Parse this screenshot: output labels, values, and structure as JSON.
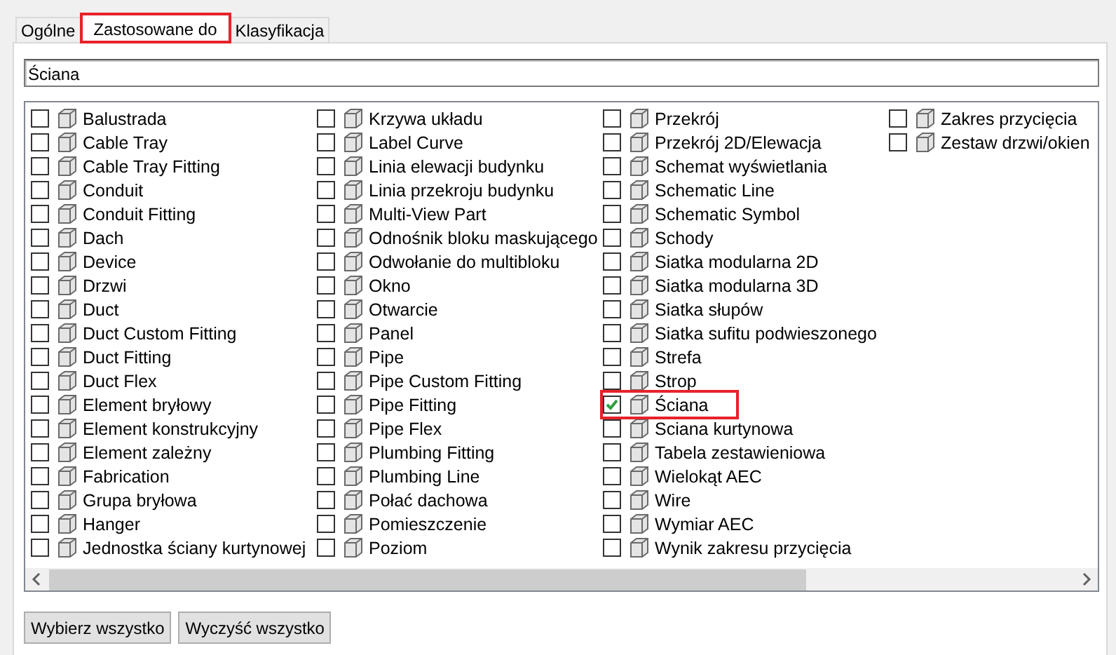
{
  "tabs": [
    {
      "label": "Ogólne",
      "selected": false,
      "highlighted": false
    },
    {
      "label": "Zastosowane do",
      "selected": true,
      "highlighted": true
    },
    {
      "label": "Klasyfikacja",
      "selected": false,
      "highlighted": false
    }
  ],
  "filter": {
    "value": "Ściana"
  },
  "columns": [
    {
      "items": [
        {
          "label": "Balustrada",
          "checked": false
        },
        {
          "label": "Cable Tray",
          "checked": false
        },
        {
          "label": "Cable Tray Fitting",
          "checked": false
        },
        {
          "label": "Conduit",
          "checked": false
        },
        {
          "label": "Conduit Fitting",
          "checked": false
        },
        {
          "label": "Dach",
          "checked": false
        },
        {
          "label": "Device",
          "checked": false
        },
        {
          "label": "Drzwi",
          "checked": false
        },
        {
          "label": "Duct",
          "checked": false
        },
        {
          "label": "Duct Custom Fitting",
          "checked": false
        },
        {
          "label": "Duct Fitting",
          "checked": false
        },
        {
          "label": "Duct Flex",
          "checked": false
        },
        {
          "label": "Element bryłowy",
          "checked": false
        },
        {
          "label": "Element konstrukcyjny",
          "checked": false
        },
        {
          "label": "Element zależny",
          "checked": false
        },
        {
          "label": "Fabrication",
          "checked": false
        },
        {
          "label": "Grupa bryłowa",
          "checked": false
        },
        {
          "label": "Hanger",
          "checked": false
        },
        {
          "label": "Jednostka ściany kurtynowej",
          "checked": false
        }
      ]
    },
    {
      "items": [
        {
          "label": "Krzywa układu",
          "checked": false
        },
        {
          "label": "Label Curve",
          "checked": false
        },
        {
          "label": "Linia elewacji budynku",
          "checked": false
        },
        {
          "label": "Linia przekroju budynku",
          "checked": false
        },
        {
          "label": "Multi-View Part",
          "checked": false
        },
        {
          "label": "Odnośnik bloku maskującego",
          "checked": false
        },
        {
          "label": "Odwołanie do multibloku",
          "checked": false
        },
        {
          "label": "Okno",
          "checked": false
        },
        {
          "label": "Otwarcie",
          "checked": false
        },
        {
          "label": "Panel",
          "checked": false
        },
        {
          "label": "Pipe",
          "checked": false
        },
        {
          "label": "Pipe Custom Fitting",
          "checked": false
        },
        {
          "label": "Pipe Fitting",
          "checked": false
        },
        {
          "label": "Pipe Flex",
          "checked": false
        },
        {
          "label": "Plumbing Fitting",
          "checked": false
        },
        {
          "label": "Plumbing Line",
          "checked": false
        },
        {
          "label": "Połać dachowa",
          "checked": false
        },
        {
          "label": "Pomieszczenie",
          "checked": false
        },
        {
          "label": "Poziom",
          "checked": false
        }
      ]
    },
    {
      "items": [
        {
          "label": "Przekrój",
          "checked": false
        },
        {
          "label": "Przekrój 2D/Elewacja",
          "checked": false
        },
        {
          "label": "Schemat wyświetlania",
          "checked": false
        },
        {
          "label": "Schematic Line",
          "checked": false
        },
        {
          "label": "Schematic Symbol",
          "checked": false
        },
        {
          "label": "Schody",
          "checked": false
        },
        {
          "label": "Siatka modularna 2D",
          "checked": false
        },
        {
          "label": "Siatka modularna 3D",
          "checked": false
        },
        {
          "label": "Siatka słupów",
          "checked": false
        },
        {
          "label": "Siatka sufitu podwieszonego",
          "checked": false
        },
        {
          "label": "Strefa",
          "checked": false
        },
        {
          "label": "Strop",
          "checked": false
        },
        {
          "label": "Ściana",
          "checked": true,
          "highlighted": true
        },
        {
          "label": "Sciana kurtynowa",
          "checked": false
        },
        {
          "label": "Tabela zestawieniowa",
          "checked": false
        },
        {
          "label": "Wielokąt AEC",
          "checked": false
        },
        {
          "label": "Wire",
          "checked": false
        },
        {
          "label": "Wymiar AEC",
          "checked": false
        },
        {
          "label": "Wynik zakresu przycięcia",
          "checked": false
        }
      ]
    },
    {
      "items": [
        {
          "label": "Zakres przycięcia",
          "checked": false
        },
        {
          "label": "Zestaw drzwi/okien",
          "checked": false
        }
      ]
    }
  ],
  "buttons": [
    "Wybierz wszystko",
    "Wyczyść wszystko"
  ]
}
